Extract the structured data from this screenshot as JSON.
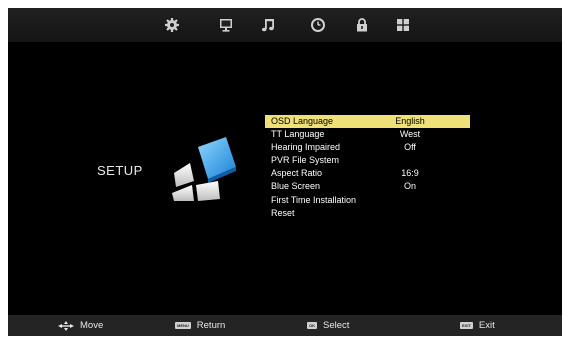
{
  "tabs": [
    {
      "icon": "gear-icon"
    },
    {
      "icon": "monitor-icon"
    },
    {
      "icon": "music-note-icon"
    },
    {
      "icon": "clock-icon"
    },
    {
      "icon": "lock-icon"
    },
    {
      "icon": "grid-icon"
    }
  ],
  "page": {
    "title": "SETUP"
  },
  "menu": {
    "items": [
      {
        "label": "OSD Language",
        "value": "English",
        "selected": true
      },
      {
        "label": "TT Language",
        "value": "West"
      },
      {
        "label": "Hearing Impaired",
        "value": "Off"
      },
      {
        "label": "PVR File System",
        "value": ""
      },
      {
        "label": "Aspect Ratio",
        "value": "16:9"
      },
      {
        "label": "Blue Screen",
        "value": "On"
      },
      {
        "label": "First Time Installation",
        "value": ""
      },
      {
        "label": "Reset",
        "value": ""
      }
    ]
  },
  "footer": {
    "move": "Move",
    "menu_key": "MENU",
    "return": "Return",
    "ok_key": "OK",
    "select": "Select",
    "exit_key": "EXIT",
    "exit": "Exit"
  },
  "colors": {
    "highlight": "#efe078",
    "background": "#000000"
  }
}
